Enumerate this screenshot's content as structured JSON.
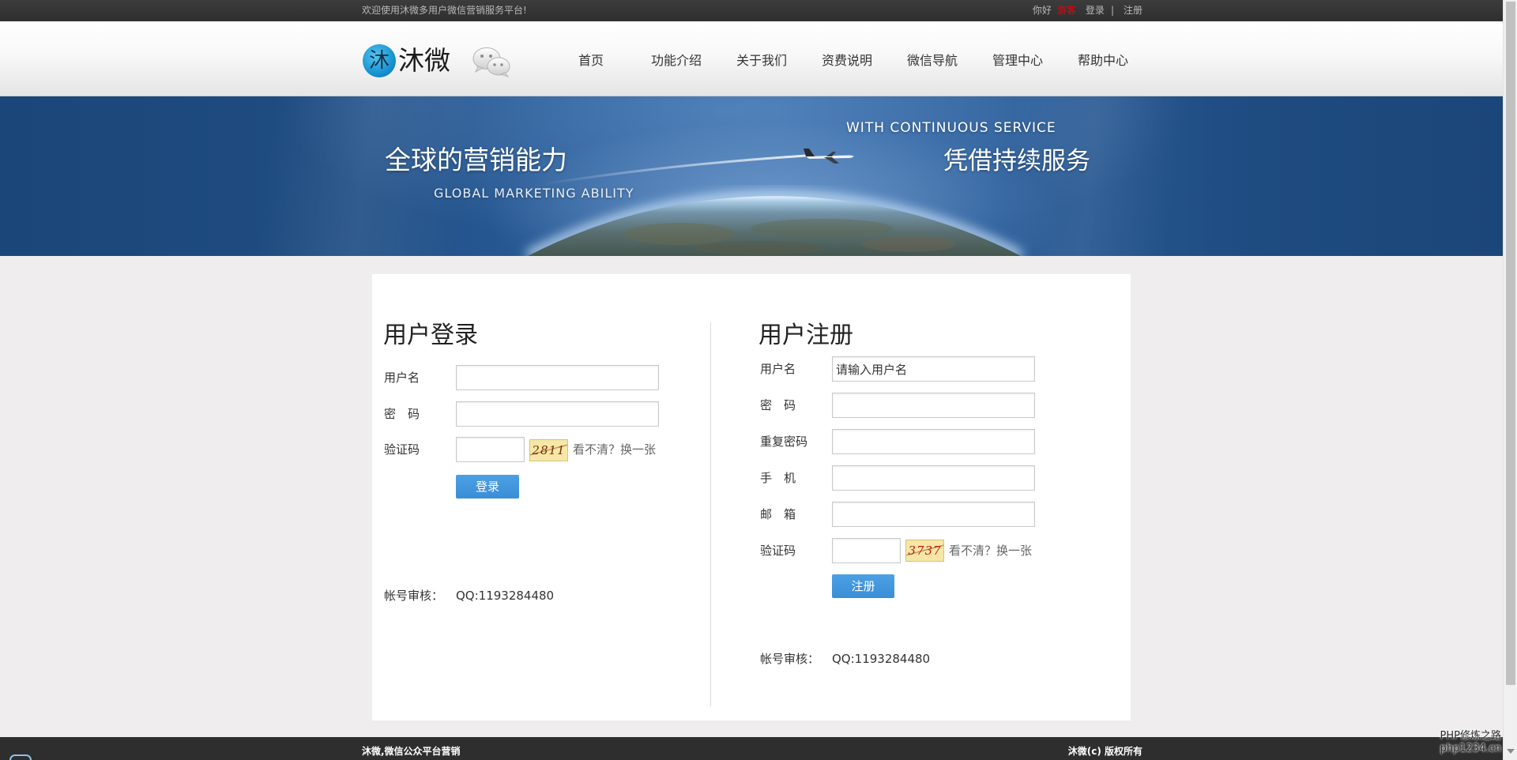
{
  "topbar": {
    "welcome": "欢迎使用沐微多用户微信营销服务平台!",
    "greeting": "你好",
    "guest": "游客",
    "login": "登录",
    "separator": "|",
    "register": "注册"
  },
  "header": {
    "logo_mark": "沐",
    "logo_text": "沐微",
    "nav": [
      "首页",
      "功能介绍",
      "关于我们",
      "资费说明",
      "微信导航",
      "管理中心",
      "帮助中心"
    ]
  },
  "banner": {
    "left_title": "全球的营销能力",
    "left_subtitle": "GLOBAL MARKETING ABILITY",
    "right_subtitle": "WITH CONTINUOUS SERVICE",
    "right_title": "凭借持续服务"
  },
  "login": {
    "title": "用户登录",
    "username_label": "用户名",
    "password_label": "密　码",
    "captcha_label": "验证码",
    "captcha_code": "2811",
    "captcha_refresh": "看不清？换一张",
    "submit": "登录",
    "review_label": "帐号审核：",
    "review_value": "QQ:1193284480"
  },
  "register": {
    "title": "用户注册",
    "username_label": "用户名",
    "username_value": "请输入用户名",
    "password_label": "密　码",
    "repeat_password_label": "重复密码",
    "phone_label": "手　机",
    "email_label": "邮　箱",
    "captcha_label": "验证码",
    "captcha_code": "3737",
    "captcha_refresh": "看不清？换一张",
    "submit": "注册",
    "review_label": "帐号审核：",
    "review_value": "QQ:1193284480"
  },
  "footer": {
    "left": "沐微,微信公众平台营销",
    "right": "沐微(c) 版权所有"
  },
  "watermark": {
    "line1": "PHP修炼之路",
    "line2": "php1234.cn"
  },
  "icons": {
    "logo": "logo-icon",
    "wechat": "wechat-icon",
    "plane": "airplane-icon",
    "scroll_down": "scroll-down-arrow-icon"
  },
  "colors": {
    "topbar_bg": "#2f2f2f",
    "footer_bg": "#2e2e2e",
    "accent_red": "#e60012",
    "button_blue": "#3a8ed6",
    "banner_blue": "#1e4b80",
    "page_bg": "#efeded"
  }
}
